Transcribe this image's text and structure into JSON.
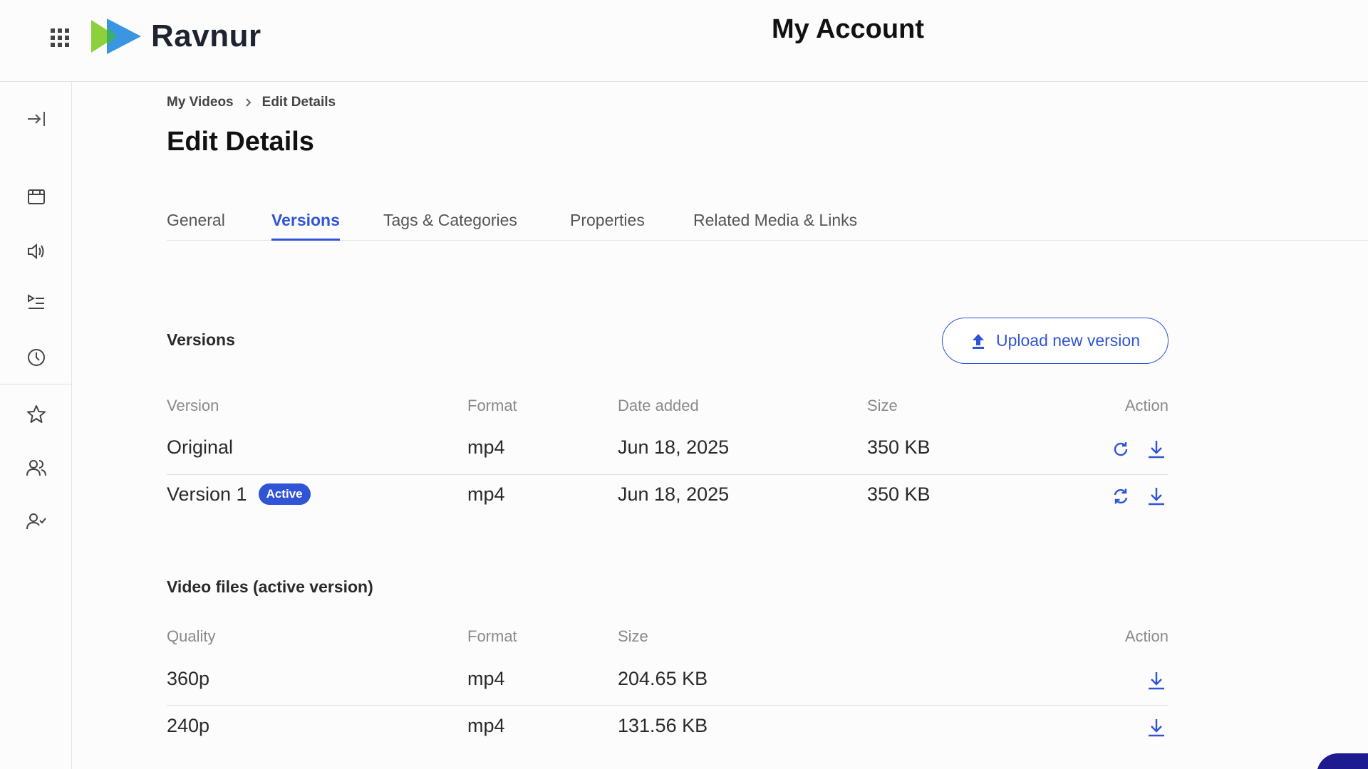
{
  "header": {
    "brand": "Ravnur",
    "title": "My Account"
  },
  "breadcrumb": {
    "items": [
      "My Videos",
      "Edit Details"
    ]
  },
  "page_title": "Edit Details",
  "tabs": [
    {
      "label": "General"
    },
    {
      "label": "Versions",
      "active": true
    },
    {
      "label": "Tags & Categories"
    },
    {
      "label": "Properties"
    },
    {
      "label": "Related Media & Links"
    }
  ],
  "versions": {
    "title": "Versions",
    "upload_label": "Upload new version",
    "columns": [
      "Version",
      "Format",
      "Date added",
      "Size",
      "Action"
    ],
    "rows": [
      {
        "version": "Original",
        "format": "mp4",
        "date": "Jun 18, 2025",
        "size": "350 KB",
        "badge": ""
      },
      {
        "version": "Version 1",
        "format": "mp4",
        "date": "Jun 18, 2025",
        "size": "350 KB",
        "badge": "Active"
      }
    ]
  },
  "files": {
    "title": "Video files (active version)",
    "columns": [
      "Quality",
      "Format",
      "Size",
      "Action"
    ],
    "rows": [
      {
        "quality": "360p",
        "format": "mp4",
        "size": "204.65 KB"
      },
      {
        "quality": "240p",
        "format": "mp4",
        "size": "131.56 KB"
      }
    ]
  },
  "sidebar": {
    "icons": [
      "expand-sidebar-icon",
      "calendar-icon",
      "speaker-icon",
      "playlist-icon",
      "clock-icon",
      "star-icon",
      "users-icon",
      "user-check-icon"
    ]
  },
  "colors": {
    "accent": "#2f54d6",
    "logo_green": "#8cd13c",
    "logo_blue": "#2f8fe0"
  }
}
